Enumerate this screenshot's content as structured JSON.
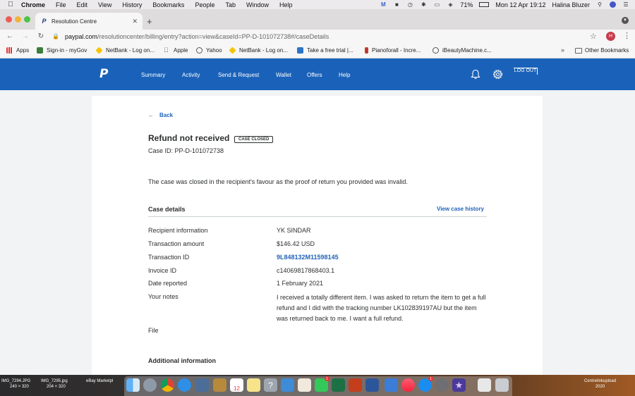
{
  "menubar": {
    "items": [
      "Chrome",
      "File",
      "Edit",
      "View",
      "History",
      "Bookmarks",
      "People",
      "Tab",
      "Window",
      "Help"
    ],
    "battery": "71%",
    "datetime": "Mon 12 Apr  19:12",
    "user": "Halina Bluzer"
  },
  "browser": {
    "tab_title": "Resolution Centre",
    "url_host": "paypal.com",
    "url_path": "/resolutioncenter/billing/entry?action=view&caseId=PP-D-101072738#/caseDetails",
    "profile_initial": "H",
    "bookmarks": [
      "Apps",
      "Sign-in - myGov",
      "NetBank - Log on...",
      "Apple",
      "Yahoo",
      "NetBank - Log on...",
      "Take a free trial |...",
      "Pianoforall - Incre...",
      "iBeautyMachine.c..."
    ],
    "bookmarks_more": "»",
    "other_bookmarks": "Other Bookmarks"
  },
  "paypal_nav": {
    "items": [
      "Summary",
      "Activity",
      "Send & Request",
      "Wallet",
      "Offers",
      "Help"
    ],
    "logout": "LOG OUT"
  },
  "case": {
    "back": "Back",
    "title": "Refund not received",
    "status": "CASE CLOSED",
    "case_id": "Case ID: PP-D-101072738",
    "summary": "The case was closed in the recipient's favour as the proof of return you provided was invalid.",
    "details_title": "Case details",
    "history_link": "View case history",
    "details": [
      {
        "label": "Recipient information",
        "value": "YK SINDAR"
      },
      {
        "label": "Transaction amount",
        "value": "$146.42 USD"
      },
      {
        "label": "Transaction ID",
        "value": "9L848132M11598145"
      },
      {
        "label": "Invoice ID",
        "value": "c14069817868403.1"
      },
      {
        "label": "Date reported",
        "value": "1 February 2021"
      },
      {
        "label": "Your notes",
        "value": "I received a totally different item. I was asked to return the item to get a full refund and I did with the tracking number LK102839197AU but the item was returned back to me. I want a full refund."
      },
      {
        "label": "File",
        "value": ""
      }
    ],
    "additional_title": "Additional information"
  },
  "desktop": {
    "files": [
      {
        "name": "IMG_7294.JPG",
        "size": "240 × 320"
      },
      {
        "name": "IMG_7295.jpg",
        "size": "204 × 320"
      },
      {
        "name": "eBay Marketpl",
        "size": ""
      },
      {
        "name": "Centrelinkupload",
        "size": "2020"
      }
    ],
    "dock_badges": [
      "1",
      "1"
    ],
    "calendar_day": "12"
  },
  "colors": {
    "paypal_blue": "#1a62b9",
    "link_blue": "#1f63b8"
  }
}
